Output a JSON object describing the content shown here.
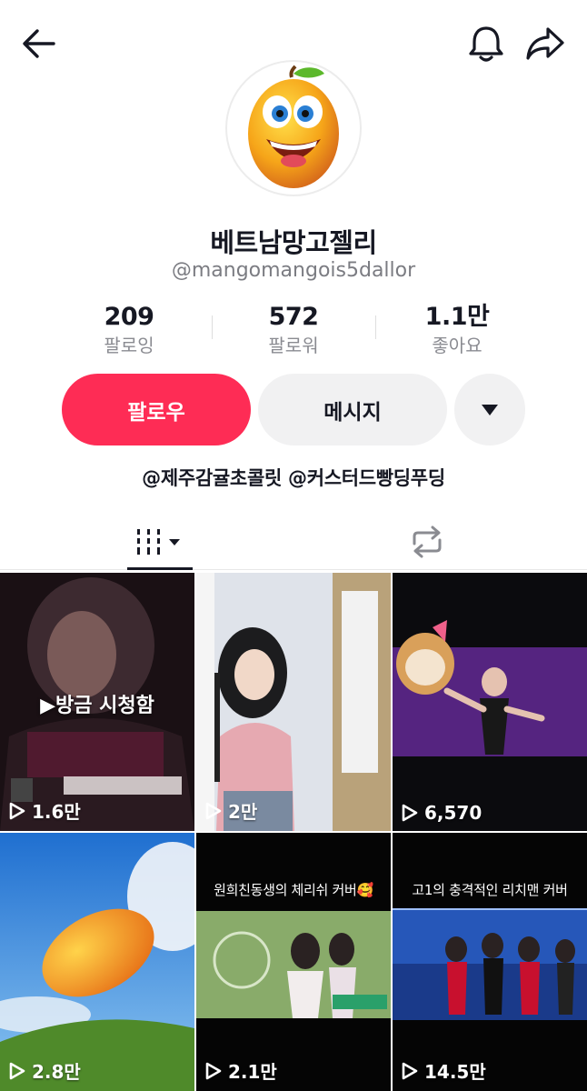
{
  "icons": {
    "back": "arrow-left-icon",
    "bell": "bell-icon",
    "share": "share-icon",
    "more": "caret-down-icon",
    "tab_videos": "grid-bars-icon",
    "tab_reposts": "repost-icon",
    "play": "play-icon"
  },
  "profile": {
    "nickname": "베트남망고젤리",
    "username": "@mangomangois5dallor",
    "bio": "@제주감귤초콜릿 @커스터드빵딩푸딩"
  },
  "stats": [
    {
      "value": "209",
      "label": "팔로잉"
    },
    {
      "value": "572",
      "label": "팔로워"
    },
    {
      "value": "1.1만",
      "label": "좋아요"
    }
  ],
  "actions": {
    "follow": "팔로우",
    "message": "메시지"
  },
  "videos": [
    {
      "views": "1.6만",
      "badge": "▶방금 시청함",
      "caption": ""
    },
    {
      "views": "2만",
      "badge": "",
      "caption": ""
    },
    {
      "views": "6,570",
      "badge": "",
      "caption": ""
    },
    {
      "views": "2.8만",
      "badge": "",
      "caption": ""
    },
    {
      "views": "2.1만",
      "badge": "",
      "caption": "원희친동생의 체리쉬 커버🥰"
    },
    {
      "views": "14.5만",
      "badge": "",
      "caption": "고1의 충격적인 리치맨 커버"
    }
  ],
  "colors": {
    "accent": "#fe2c55",
    "button_gray": "#f1f1f2",
    "text": "#161823",
    "muted": "#8a8b91"
  }
}
